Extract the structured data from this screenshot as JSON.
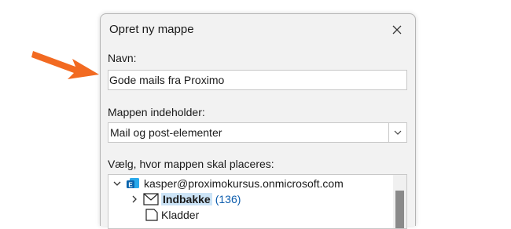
{
  "dialog": {
    "title": "Opret ny mappe",
    "name_label": "Navn:",
    "name_value": "Gode mails fra Proximo",
    "contains_label": "Mappen indeholder:",
    "contains_value": "Mail og post-elementer",
    "location_label": "Vælg, hvor mappen skal placeres:"
  },
  "tree": {
    "account": "kasper@proximokursus.onmicrosoft.com",
    "inbox_label": "Indbakke",
    "inbox_count": "(136)",
    "drafts_label": "Kladder"
  },
  "colors": {
    "arrow": "#f26a21",
    "selection": "#cce4f7",
    "count_link": "#0b5cad"
  }
}
